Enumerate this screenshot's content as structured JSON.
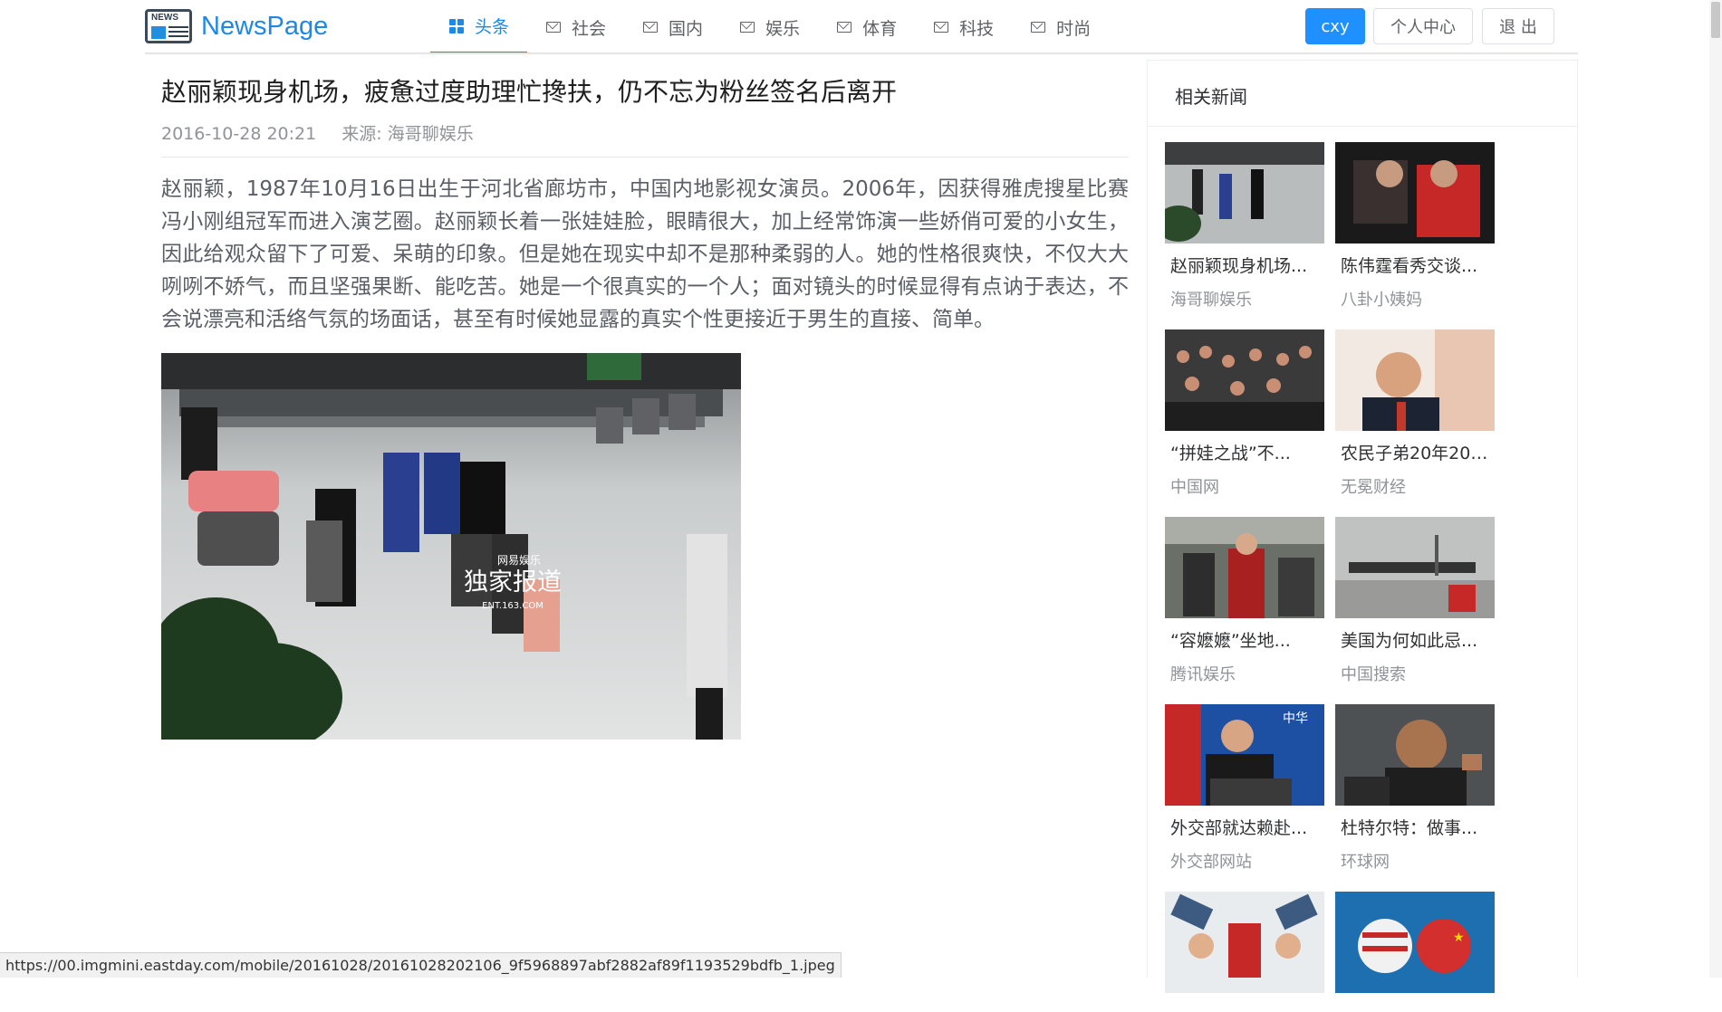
{
  "app": {
    "logo_badge": "NEWS",
    "logo_text": "NewsPage"
  },
  "nav": {
    "items": [
      {
        "label": "头条",
        "icon": "grid-icon",
        "active": true
      },
      {
        "label": "社会",
        "icon": "mail-icon"
      },
      {
        "label": "国内",
        "icon": "mail-icon"
      },
      {
        "label": "娱乐",
        "icon": "mail-icon"
      },
      {
        "label": "体育",
        "icon": "mail-icon"
      },
      {
        "label": "科技",
        "icon": "mail-icon"
      },
      {
        "label": "时尚",
        "icon": "mail-icon"
      }
    ]
  },
  "user": {
    "name": "cxy",
    "center_label": "个人中心",
    "logout_label": "退 出"
  },
  "article": {
    "title": "赵丽颖现身机场，疲惫过度助理忙搀扶，仍不忘为粉丝签名后离开",
    "date": "2016-10-28 20:21",
    "source_label": "来源:",
    "source": "海哥聊娱乐",
    "body": "赵丽颖，1987年10月16日出生于河北省廊坊市，中国内地影视女演员。2006年，因获得雅虎搜星比赛冯小刚组冠军而进入演艺圈。赵丽颖长着一张娃娃脸，眼睛很大，加上经常饰演一些娇俏可爱的小女生，因此给观众留下了可爱、呆萌的印象。但是她在现实中却不是那种柔弱的人。她的性格很爽快，不仅大大咧咧不娇气，而且坚强果断、能吃苦。她是一个很真实的一个人；面对镜头的时候显得有点讷于表达，不会说漂亮和活络气氛的场面话，甚至有时候她显露的真实个性更接近于男生的直接、简单。",
    "photo_watermark_brand": "网易娱乐",
    "photo_watermark_main": "独家报道",
    "photo_watermark_url": "ENT.163.COM"
  },
  "sidebar": {
    "title": "相关新闻",
    "items": [
      {
        "title": "赵丽颖现身机场...",
        "source": "海哥聊娱乐"
      },
      {
        "title": "陈伟霆看秀交谈...",
        "source": "八卦小姨妈"
      },
      {
        "title": "“拼娃之战”不...",
        "source": "中国网"
      },
      {
        "title": "农民子弟20年200...",
        "source": "无冕财经"
      },
      {
        "title": "“容嬷嬷”坐地...",
        "source": "腾讯娱乐"
      },
      {
        "title": "美国为何如此忌...",
        "source": "中国搜索"
      },
      {
        "title": "外交部就达赖赴...",
        "source": "外交部网站"
      },
      {
        "title": "杜特尔特：做事...",
        "source": "环球网"
      },
      {
        "title": "",
        "source": ""
      },
      {
        "title": "",
        "source": ""
      }
    ]
  },
  "status_bar": {
    "url": "https://00.imgmini.eastday.com/mobile/20161028/20161028202106_9f5968897abf2882af89f1193529bdfb_1.jpeg"
  }
}
